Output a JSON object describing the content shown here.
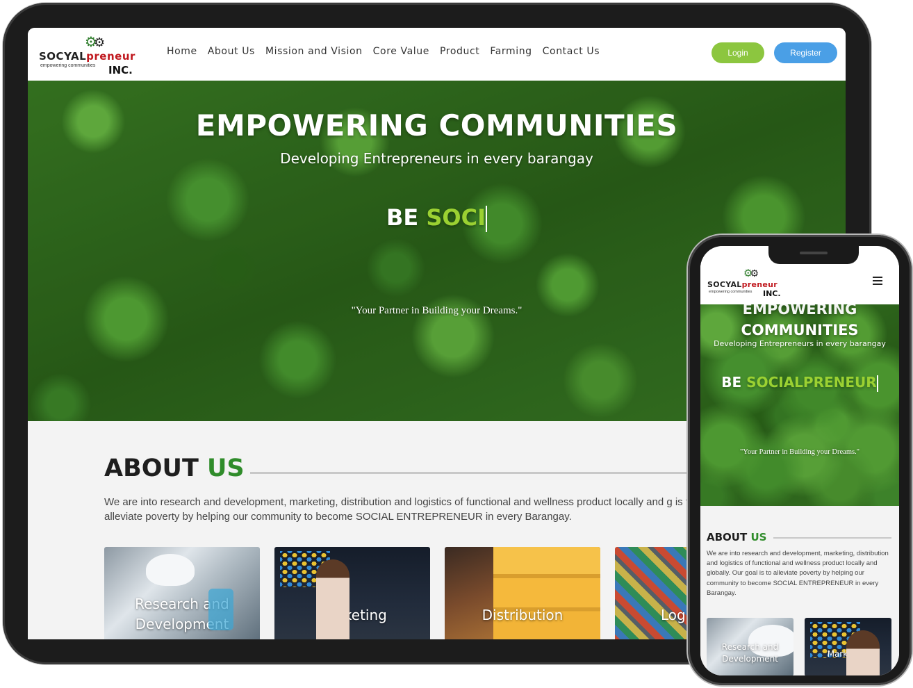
{
  "brand": {
    "name_prefix": "SOCYAL",
    "name_suffix": "preneur",
    "tagline": "empowering communities",
    "inc": "INC."
  },
  "nav": {
    "items": [
      "Home",
      "About Us",
      "Mission and Vision",
      "Core Value",
      "Product",
      "Farming",
      "Contact Us"
    ],
    "login_label": "Login",
    "register_label": "Register"
  },
  "hero": {
    "title": "EMPOWERING COMMUNITIES",
    "subtitle": "Developing Entrepreneurs in every barangay",
    "be_prefix": "BE",
    "typed_tablet": "SOCI",
    "typed_phone": "SOCIALPRENEUR",
    "quote": "\"Your Partner in Building your Dreams.\""
  },
  "about": {
    "title_main": "ABOUT",
    "title_accent": "US",
    "text_tablet": "We are into research and development, marketing, distribution and logistics of functional and wellness product locally and g is to alleviate poverty by helping our community to become SOCIAL ENTREPRENEUR in every Barangay.",
    "text_phone": "We are into research and development, marketing, distribution and logistics of functional and wellness product locally and globally. Our goal is to alleviate poverty by helping our community to become SOCIAL ENTREPRENEUR in every Barangay.",
    "cards": [
      {
        "label": "Research and Development"
      },
      {
        "label": "Marketing"
      },
      {
        "label": "Distribution"
      },
      {
        "label": "Log"
      }
    ]
  },
  "phone_hero": {
    "title_cut": "EMPOWERING",
    "title_line2": "COMMUNITIES"
  },
  "icons": {
    "gear": "gear-icon",
    "menu": "hamburger-menu-icon"
  },
  "colors": {
    "accent_green": "#2f8c2a",
    "typed_green": "#9bd132",
    "login_green": "#8cc63f",
    "register_blue": "#4a9fe6",
    "brand_red": "#c0181e"
  }
}
